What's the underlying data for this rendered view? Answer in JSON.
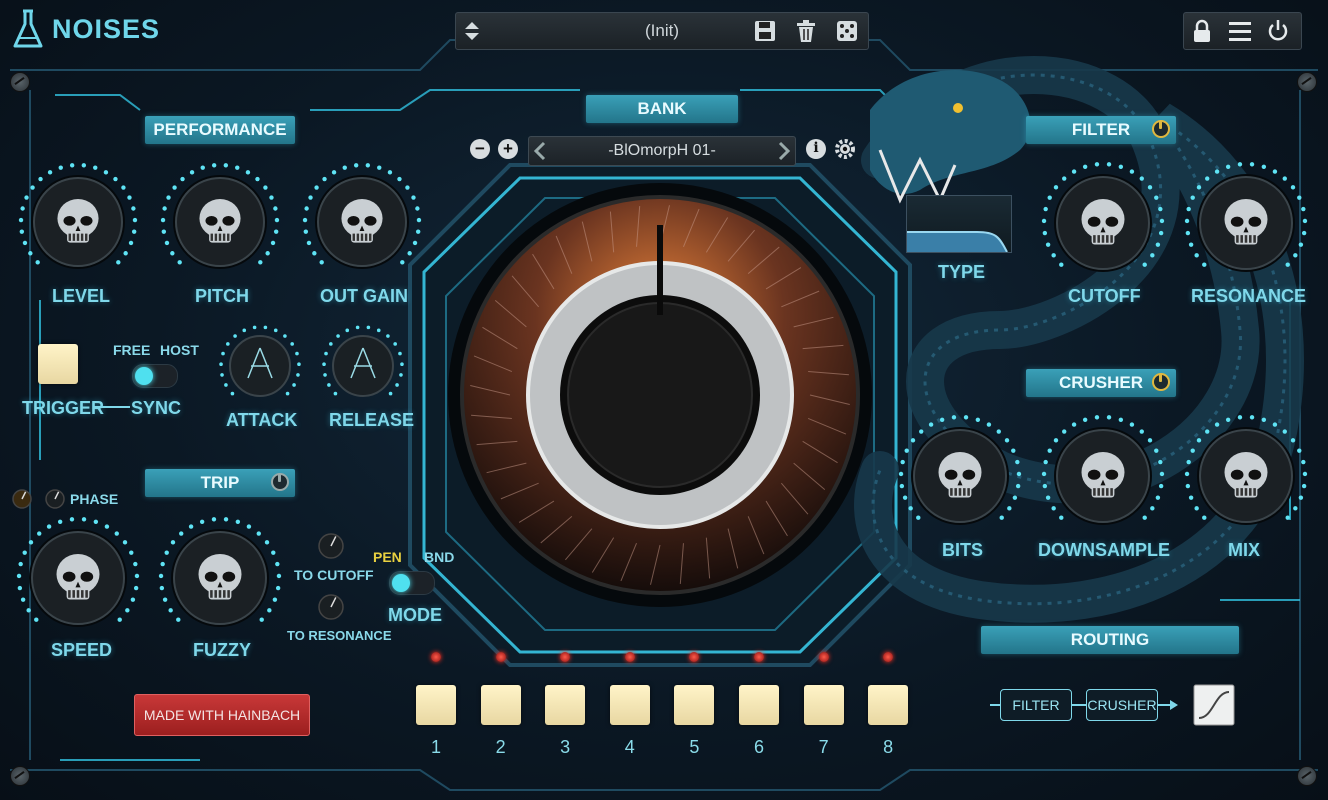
{
  "app": {
    "title": "NOISES"
  },
  "preset": {
    "name": "(Init)"
  },
  "icons": {
    "logo": "flask-icon",
    "preset_arrows": "up-down-arrows-icon",
    "save": "floppy-disk-icon",
    "delete": "trash-icon",
    "random": "dice-icon",
    "lock": "lock-icon",
    "menu": "hamburger-menu-icon",
    "power": "power-icon",
    "decor": "serpent-illustration"
  },
  "colors": {
    "accent": "#3aa0b8",
    "text": "#7fd8ea",
    "pad": "#fff4c8",
    "led": "#ff3020",
    "made_button": "#c83838",
    "power_on": "#e0b840"
  },
  "performance": {
    "title": "PERFORMANCE",
    "level": "LEVEL",
    "pitch": "PITCH",
    "out_gain": "OUT GAIN",
    "trigger": "TRIGGER",
    "sync": "SYNC",
    "free": "FREE",
    "host": "HOST",
    "attack": "ATTACK",
    "release": "RELEASE"
  },
  "trip": {
    "title": "TRIP",
    "phase": "PHASE",
    "speed": "SPEED",
    "fuzzy": "FUZZY",
    "to_cutoff": "TO CUTOFF",
    "to_resonance": "TO RESONANCE",
    "pen": "PEN",
    "bnd": "BND",
    "mode": "MODE"
  },
  "bank": {
    "title": "BANK",
    "name": "-BlOmorpH 01-"
  },
  "filter": {
    "title": "FILTER",
    "type": "TYPE",
    "cutoff": "CUTOFF",
    "resonance": "RESONANCE"
  },
  "crusher": {
    "title": "CRUSHER",
    "bits": "BITS",
    "downsample": "DOWNSAMPLE",
    "mix": "MIX"
  },
  "routing": {
    "title": "ROUTING",
    "first": "FILTER",
    "second": "CRUSHER"
  },
  "pads": [
    "1",
    "2",
    "3",
    "4",
    "5",
    "6",
    "7",
    "8"
  ],
  "made_with": "MADE WITH HAINBACH"
}
